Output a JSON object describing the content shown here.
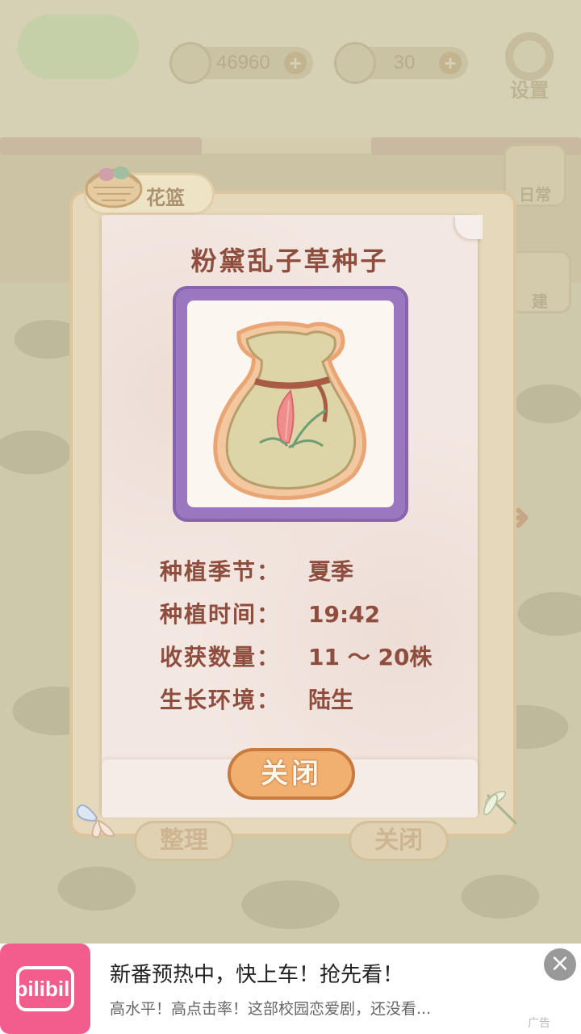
{
  "background": {
    "fish_count": "46960",
    "cheese_count": "30",
    "settings_label": "设置",
    "side_label_1": "日常",
    "side_label_2": "建",
    "basket_tab_label": "花篮",
    "organize_label": "整理",
    "bg_close_label": "关闭"
  },
  "card": {
    "title": "粉黛乱子草种子",
    "image_icon": "seed-bag-icon",
    "rows": [
      {
        "key": "种植季节：",
        "value": "夏季"
      },
      {
        "key": "种植时间：",
        "value": "19:42"
      },
      {
        "key": "收获数量：",
        "value": "11 ～ 20株"
      },
      {
        "key": "生长环境：",
        "value": "陆生"
      }
    ],
    "close_label": "关闭"
  },
  "ad": {
    "brand": "bilibili",
    "title": "新番预热中，快上车！抢先看！",
    "desc": "高水平！高点击率！这部校园恋爱剧，还没看...",
    "tag": "广告",
    "close_glyph": "×"
  },
  "colors": {
    "title_brown": "#8f4d3e",
    "frame_purple": "#9b77bf",
    "button_orange": "#f2b070",
    "ad_pink": "#f25d8e"
  }
}
